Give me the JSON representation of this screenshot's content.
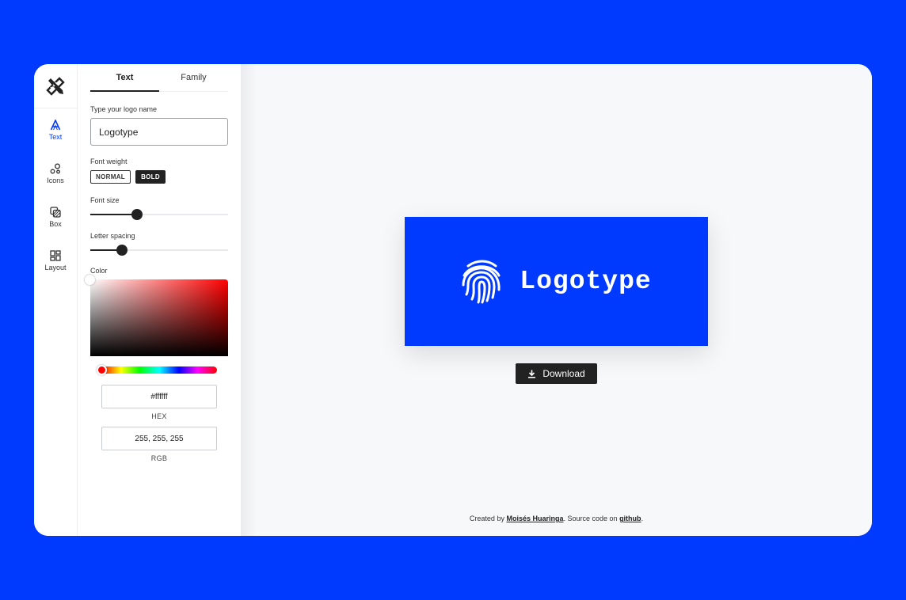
{
  "sidebar": {
    "items": [
      {
        "label": "Text",
        "icon": "text-icon",
        "active": true
      },
      {
        "label": "Icons",
        "icon": "shapes-icon",
        "active": false
      },
      {
        "label": "Box",
        "icon": "layers-icon",
        "active": false
      },
      {
        "label": "Layout",
        "icon": "layout-grid-icon",
        "active": false
      }
    ]
  },
  "panel": {
    "tabs": [
      {
        "label": "Text",
        "active": true
      },
      {
        "label": "Family",
        "active": false
      }
    ],
    "name_label": "Type your logo name",
    "name_value": "Logotype",
    "font_weight_label": "Font weight",
    "weight_normal": "NORMAL",
    "weight_bold": "BOLD",
    "selected_weight": "BOLD",
    "font_size_label": "Font size",
    "font_size_level": 0.34,
    "letter_spacing_label": "Letter spacing",
    "letter_spacing_level": 0.23,
    "color_label": "Color",
    "hex_value": "#ffffff",
    "hex_label": "HEX",
    "rgb_value": "255, 255, 255",
    "rgb_label": "RGB"
  },
  "preview": {
    "logo_text": "Logotype",
    "icon": "fingerprint-icon",
    "background": "#0039ff",
    "text_color": "#ffffff"
  },
  "download_label": "Download",
  "credits": {
    "prefix": "Created by",
    "author": "Moisés Huaringa",
    "middle": ". Source code on",
    "repo": "github",
    "suffix": "."
  },
  "colors": {
    "page_background": "#0039ff",
    "accent": "#0039ff",
    "dark": "#222222"
  }
}
